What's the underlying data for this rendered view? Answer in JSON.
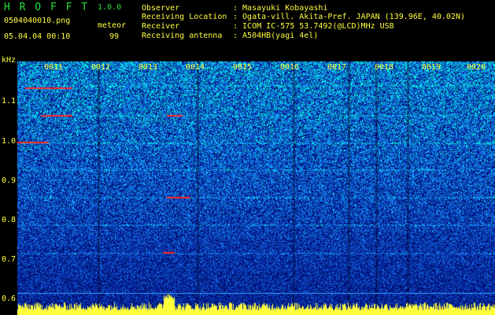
{
  "header": {
    "app_name": "H R O F F T",
    "version": "1.0.0",
    "filename": "0504040010.png",
    "mode": "meteor",
    "datetime": "05.04.04 00:10",
    "count": "99"
  },
  "info": {
    "observer_label": "Observer",
    "observer_value": ": Masayuki Kobayashi",
    "location_label": "Receiving Location",
    "location_value": ": Ogata-vill. Akita-Pref. JAPAN (139.96E, 40.02N)",
    "receiver_label": "Receiver",
    "receiver_value": ": ICOM IC-575 53.7492(@LCD)MHz USB",
    "antenna_label": "Receiving antenna",
    "antenna_value": ": A504HB(yagi 4el)"
  },
  "axis": {
    "y_unit": "kHz",
    "y_ticks": [
      "1.1",
      "1.0",
      "0.9",
      "0.8",
      "0.7",
      "0.6"
    ],
    "x_ticks": [
      "0011",
      "0012",
      "0013",
      "0014",
      "0015",
      "0016",
      "0017",
      "0018",
      "0019",
      "0020"
    ]
  },
  "colors": {
    "green": "#22e03a",
    "yellow": "#ffff3c",
    "spectrogram_low": "#00107a",
    "spectrogram_mid": "#1a7dff",
    "spectrogram_high": "#00ffd0",
    "signal": "#ff2020"
  }
}
